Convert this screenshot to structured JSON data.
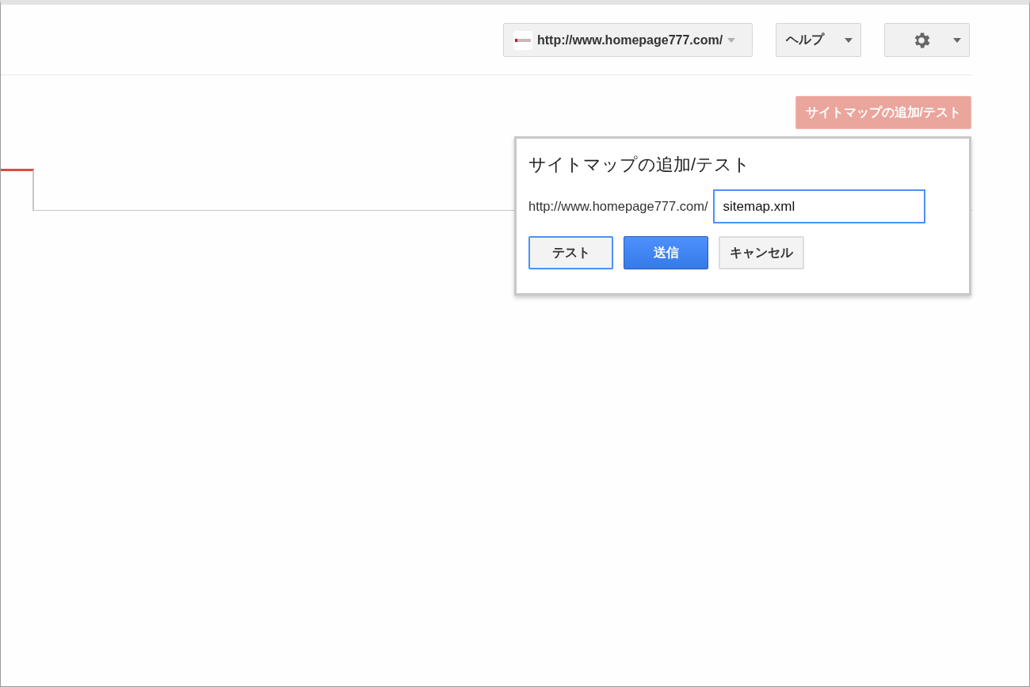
{
  "header": {
    "site_selector": {
      "label": "http://www.homepage777.com/"
    },
    "help_menu": {
      "label": "ヘルプ"
    }
  },
  "add_sitemap_button": {
    "label": "サイトマップの追加/テスト",
    "disabled": true
  },
  "dialog": {
    "title": "サイトマップの追加/テスト",
    "url_prefix": "http://www.homepage777.com/",
    "input": {
      "value": "sitemap.xml"
    },
    "buttons": [
      {
        "label": "テスト",
        "kind": "focused"
      },
      {
        "label": "送信",
        "kind": "primary"
      },
      {
        "label": "キャンセル",
        "kind": "default"
      }
    ]
  }
}
